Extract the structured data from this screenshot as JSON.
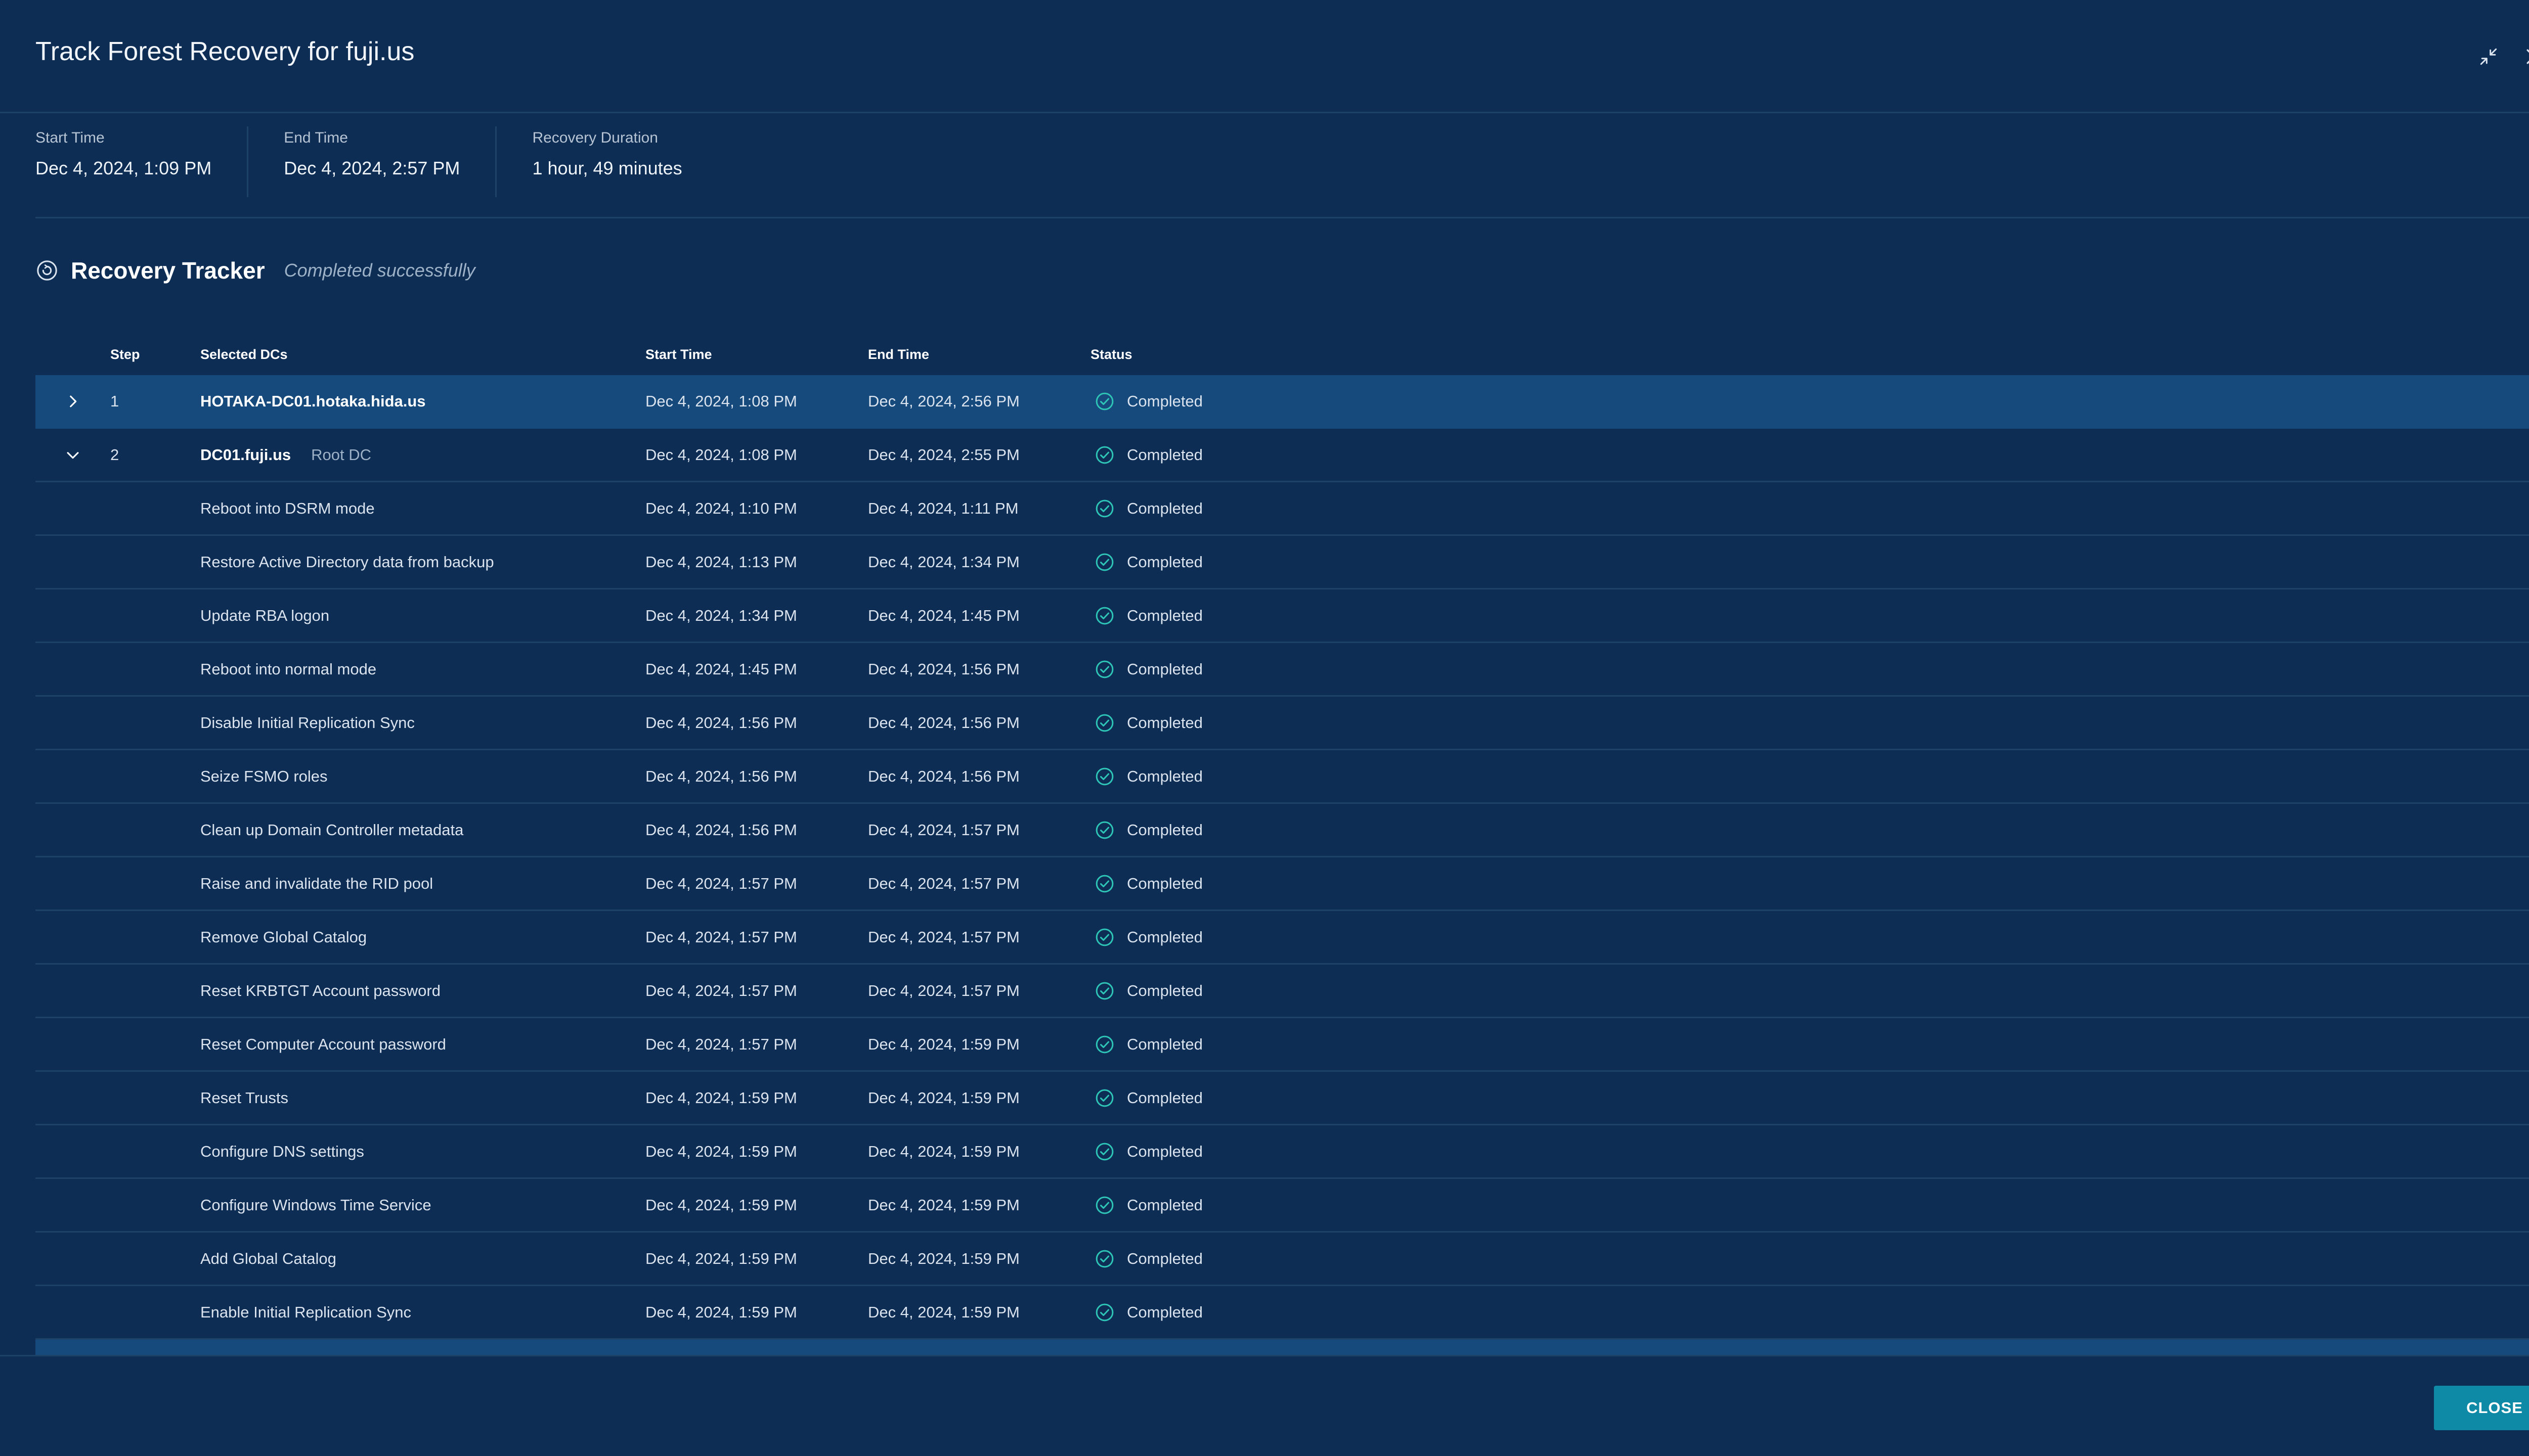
{
  "dialog": {
    "title": "Track Forest Recovery for fuji.us"
  },
  "summary": {
    "start_label": "Start Time",
    "start_value": "Dec 4, 2024, 1:09 PM",
    "end_label": "End Time",
    "end_value": "Dec 4, 2024, 2:57 PM",
    "duration_label": "Recovery Duration",
    "duration_value": "1 hour, 49 minutes"
  },
  "tracker": {
    "title": "Recovery Tracker",
    "status": "Completed successfully"
  },
  "table": {
    "headers": {
      "step": "Step",
      "dcs": "Selected DCs",
      "start": "Start Time",
      "end": "End Time",
      "status": "Status"
    },
    "dc_rows": [
      {
        "step": "1",
        "name": "HOTAKA-DC01.hotaka.hida.us",
        "tag": "",
        "start": "Dec 4, 2024, 1:08 PM",
        "end": "Dec 4, 2024, 2:56 PM",
        "status": "Completed",
        "expanded": false,
        "selected": true
      },
      {
        "step": "2",
        "name": "DC01.fuji.us",
        "tag": "Root DC",
        "start": "Dec 4, 2024, 1:08 PM",
        "end": "Dec 4, 2024, 2:55 PM",
        "status": "Completed",
        "expanded": true,
        "selected": false
      }
    ],
    "sub_steps": [
      {
        "name": "Reboot into DSRM mode",
        "start": "Dec 4, 2024, 1:10 PM",
        "end": "Dec 4, 2024, 1:11 PM",
        "status": "Completed"
      },
      {
        "name": "Restore Active Directory data from backup",
        "start": "Dec 4, 2024, 1:13 PM",
        "end": "Dec 4, 2024, 1:34 PM",
        "status": "Completed"
      },
      {
        "name": "Update RBA logon",
        "start": "Dec 4, 2024, 1:34 PM",
        "end": "Dec 4, 2024, 1:45 PM",
        "status": "Completed"
      },
      {
        "name": "Reboot into normal mode",
        "start": "Dec 4, 2024, 1:45 PM",
        "end": "Dec 4, 2024, 1:56 PM",
        "status": "Completed"
      },
      {
        "name": "Disable Initial Replication Sync",
        "start": "Dec 4, 2024, 1:56 PM",
        "end": "Dec 4, 2024, 1:56 PM",
        "status": "Completed"
      },
      {
        "name": "Seize FSMO roles",
        "start": "Dec 4, 2024, 1:56 PM",
        "end": "Dec 4, 2024, 1:56 PM",
        "status": "Completed"
      },
      {
        "name": "Clean up Domain Controller metadata",
        "start": "Dec 4, 2024, 1:56 PM",
        "end": "Dec 4, 2024, 1:57 PM",
        "status": "Completed"
      },
      {
        "name": "Raise and invalidate the RID pool",
        "start": "Dec 4, 2024, 1:57 PM",
        "end": "Dec 4, 2024, 1:57 PM",
        "status": "Completed"
      },
      {
        "name": "Remove Global Catalog",
        "start": "Dec 4, 2024, 1:57 PM",
        "end": "Dec 4, 2024, 1:57 PM",
        "status": "Completed"
      },
      {
        "name": "Reset KRBTGT Account password",
        "start": "Dec 4, 2024, 1:57 PM",
        "end": "Dec 4, 2024, 1:57 PM",
        "status": "Completed"
      },
      {
        "name": "Reset Computer Account password",
        "start": "Dec 4, 2024, 1:57 PM",
        "end": "Dec 4, 2024, 1:59 PM",
        "status": "Completed"
      },
      {
        "name": "Reset Trusts",
        "start": "Dec 4, 2024, 1:59 PM",
        "end": "Dec 4, 2024, 1:59 PM",
        "status": "Completed"
      },
      {
        "name": "Configure DNS settings",
        "start": "Dec 4, 2024, 1:59 PM",
        "end": "Dec 4, 2024, 1:59 PM",
        "status": "Completed"
      },
      {
        "name": "Configure Windows Time Service",
        "start": "Dec 4, 2024, 1:59 PM",
        "end": "Dec 4, 2024, 1:59 PM",
        "status": "Completed"
      },
      {
        "name": "Add Global Catalog",
        "start": "Dec 4, 2024, 1:59 PM",
        "end": "Dec 4, 2024, 1:59 PM",
        "status": "Completed"
      },
      {
        "name": "Enable Initial Replication Sync",
        "start": "Dec 4, 2024, 1:59 PM",
        "end": "Dec 4, 2024, 1:59 PM",
        "status": "Completed"
      }
    ]
  },
  "footer": {
    "close_label": "CLOSE"
  },
  "colors": {
    "background": "#0d2d55",
    "selected_row": "#164a7c",
    "divider": "#1d4268",
    "success": "#2ec4b6",
    "close_button": "#0f8aa6"
  },
  "icons": {
    "minimize": "minimize-arrows-icon",
    "close": "close-icon",
    "tracker": "recovery-tracker-icon",
    "expand": "chevron-right-icon",
    "collapse": "chevron-down-icon",
    "status": "check-circle-icon"
  }
}
